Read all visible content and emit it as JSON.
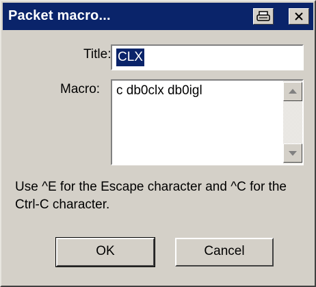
{
  "window": {
    "title": "Packet macro...",
    "titlebar_color": "#0a246a",
    "buttons": [
      {
        "icon": "printer-icon"
      },
      {
        "icon": "close-icon"
      }
    ]
  },
  "form": {
    "title_label": "Title:",
    "title_value": "CLX",
    "macro_label": "Macro:",
    "macro_value": "c db0clx db0igl"
  },
  "help_text": "Use ^E for the Escape character and ^C for the Ctrl-C character.",
  "actions": {
    "ok_label": "OK",
    "cancel_label": "Cancel"
  }
}
